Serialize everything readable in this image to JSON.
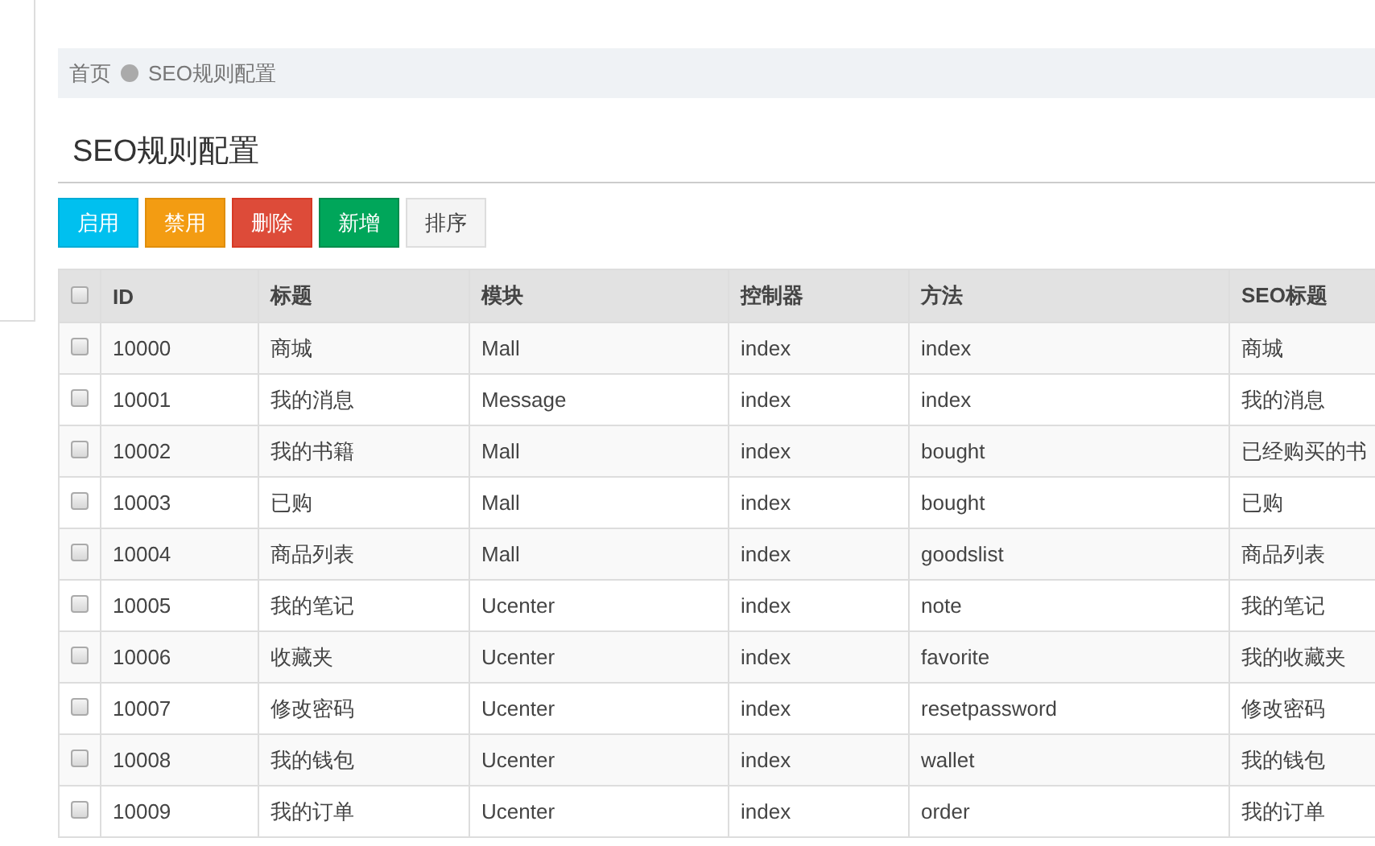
{
  "breadcrumb": {
    "items": [
      "首页",
      "SEO规则配置"
    ]
  },
  "page_title": "SEO规则配置",
  "toolbar": [
    {
      "label": "启用",
      "kind": "info"
    },
    {
      "label": "禁用",
      "kind": "warning"
    },
    {
      "label": "删除",
      "kind": "danger"
    },
    {
      "label": "新增",
      "kind": "success"
    },
    {
      "label": "排序",
      "kind": "default"
    }
  ],
  "table": {
    "select_all": {
      "checked": false
    },
    "columns": [
      "ID",
      "标题",
      "模块",
      "控制器",
      "方法",
      "SEO标题"
    ],
    "rows": [
      {
        "checked": false,
        "cells": [
          "10000",
          "商城",
          "Mall",
          "index",
          "index",
          "商城"
        ]
      },
      {
        "checked": false,
        "cells": [
          "10001",
          "我的消息",
          "Message",
          "index",
          "index",
          "我的消息"
        ]
      },
      {
        "checked": false,
        "cells": [
          "10002",
          "我的书籍",
          "Mall",
          "index",
          "bought",
          "已经购买的书"
        ]
      },
      {
        "checked": false,
        "cells": [
          "10003",
          "已购",
          "Mall",
          "index",
          "bought",
          "已购"
        ]
      },
      {
        "checked": false,
        "cells": [
          "10004",
          "商品列表",
          "Mall",
          "index",
          "goodslist",
          "商品列表"
        ]
      },
      {
        "checked": false,
        "cells": [
          "10005",
          "我的笔记",
          "Ucenter",
          "index",
          "note",
          "我的笔记"
        ]
      },
      {
        "checked": false,
        "cells": [
          "10006",
          "收藏夹",
          "Ucenter",
          "index",
          "favorite",
          "我的收藏夹"
        ]
      },
      {
        "checked": false,
        "cells": [
          "10007",
          "修改密码",
          "Ucenter",
          "index",
          "resetpassword",
          "修改密码"
        ]
      },
      {
        "checked": false,
        "cells": [
          "10008",
          "我的钱包",
          "Ucenter",
          "index",
          "wallet",
          "我的钱包"
        ]
      },
      {
        "checked": false,
        "cells": [
          "10009",
          "我的订单",
          "Ucenter",
          "index",
          "order",
          "我的订单"
        ]
      }
    ]
  }
}
